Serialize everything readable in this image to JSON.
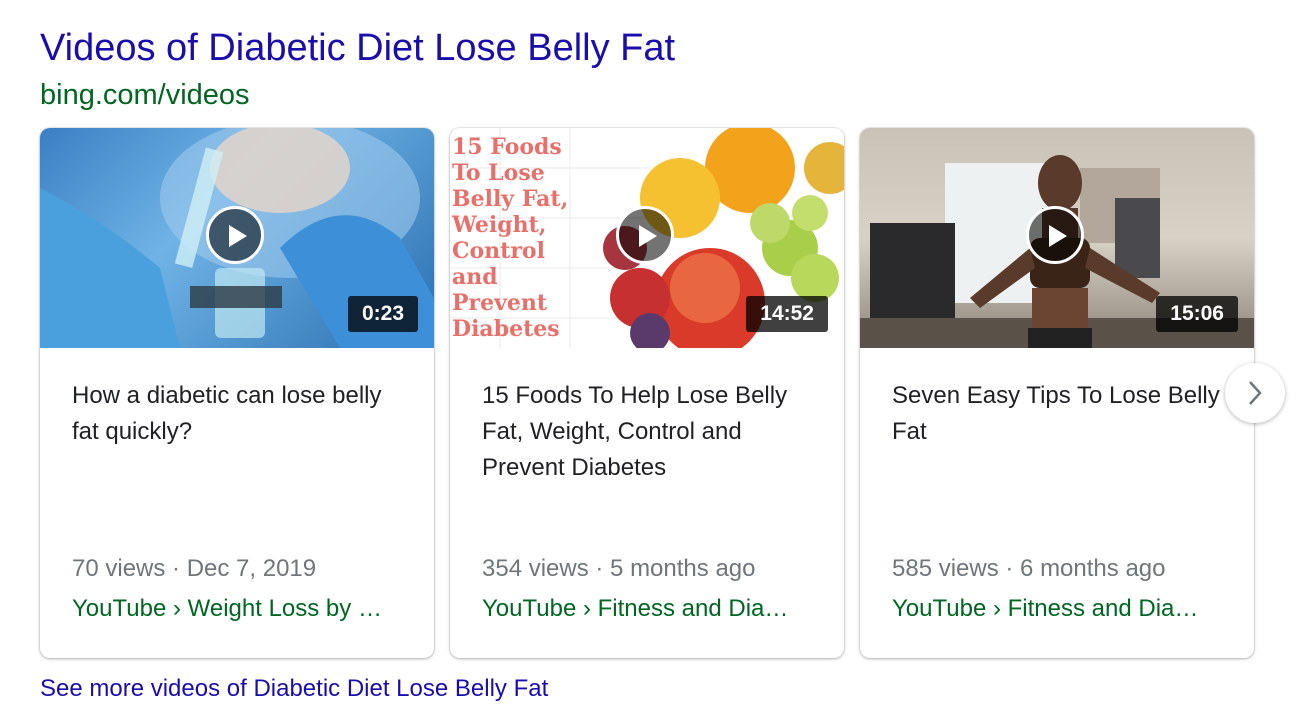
{
  "header": {
    "title": "Videos of Diabetic Diet Lose Belly Fat",
    "source": "bing.com/videos"
  },
  "cards": [
    {
      "duration": "0:23",
      "title": "How a diabetic can lose belly fat quickly?",
      "meta": "70 views · Dec 7, 2019",
      "path": "YouTube › Weight Loss by …"
    },
    {
      "duration": "14:52",
      "title": "15 Foods To Help Lose Belly Fat, Weight, Control and Prevent Diabetes",
      "meta": "354 views · 5 months ago",
      "path": "YouTube › Fitness and Dia…",
      "thumb_text": "15 Foods\nTo Lose\nBelly Fat,\nWeight,\nControl\nand\nPrevent\nDiabetes"
    },
    {
      "duration": "15:06",
      "title": "Seven Easy Tips To Lose Belly Fat",
      "meta": "585 views · 6 months ago",
      "path": "YouTube › Fitness and Dia…"
    }
  ],
  "footer": {
    "see_more": "See more videos of Diabetic Diet Lose Belly Fat"
  },
  "icons": {
    "play": "play-icon",
    "next": "chevron-right-icon"
  },
  "colors": {
    "link": "#1a0dab",
    "source_green": "#006621",
    "meta_gray": "#70757a"
  }
}
